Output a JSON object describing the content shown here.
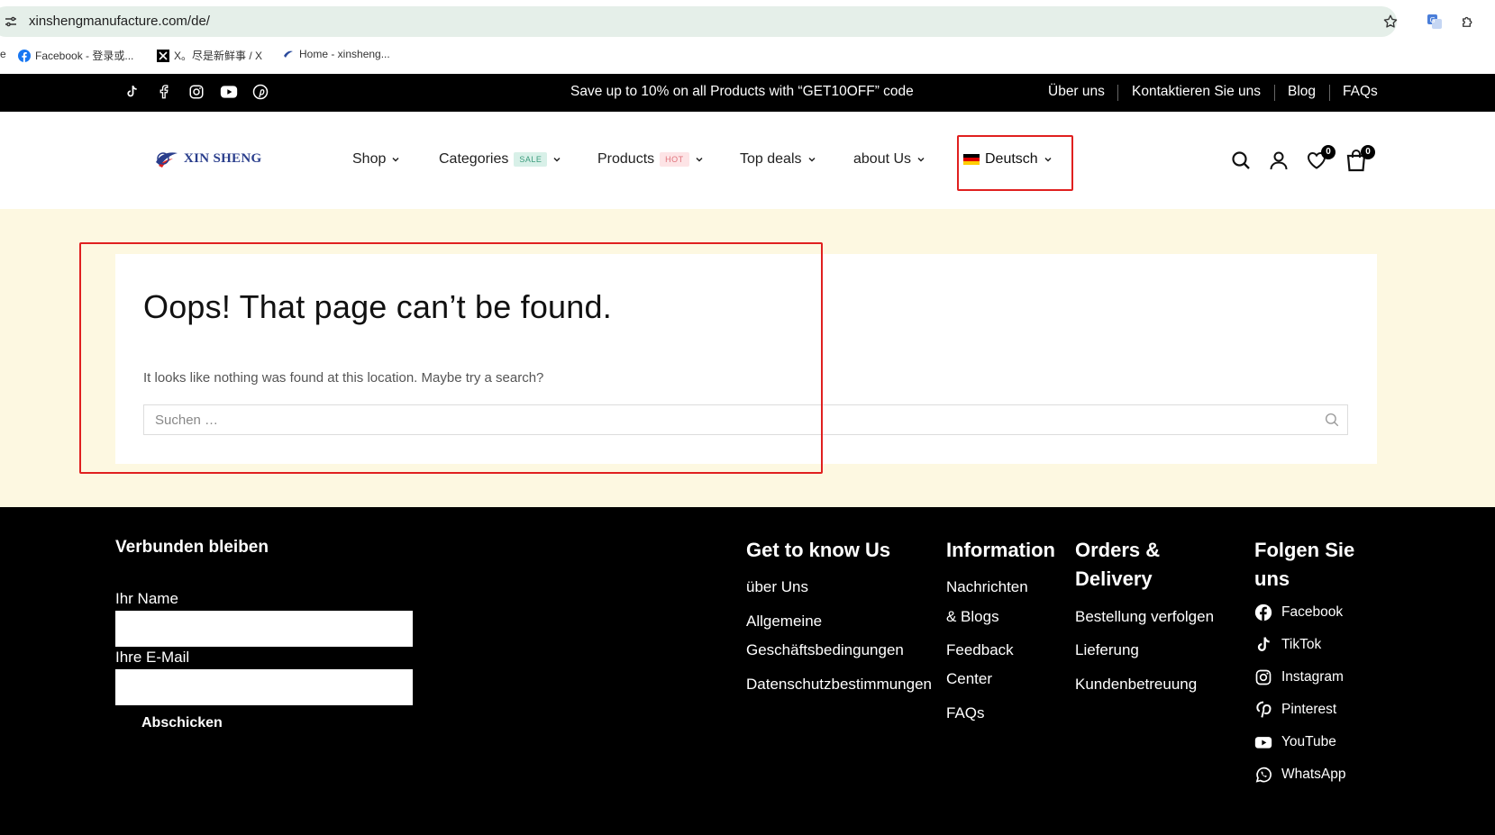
{
  "browser": {
    "url": "xinshengmanufacture.com/de/",
    "bookmarks": [
      {
        "label": "Facebook - 登录或..."
      },
      {
        "label": "X。尽是新鲜事 / X"
      },
      {
        "label": "Home - xinsheng..."
      }
    ]
  },
  "topbar": {
    "promo": "Save up to 10% on all Products with “GET10OFF” code",
    "links": [
      "Über uns",
      "Kontaktieren Sie uns",
      "Blog",
      "FAQs"
    ],
    "social_icons": [
      "tiktok-icon",
      "facebook-icon",
      "instagram-icon",
      "youtube-icon",
      "pinterest-icon"
    ]
  },
  "header": {
    "logo_text": "XIN SHENG",
    "nav": [
      {
        "label": "Shop",
        "badge": ""
      },
      {
        "label": "Categories",
        "badge": "SALE"
      },
      {
        "label": "Products",
        "badge": "HOT"
      },
      {
        "label": "Top deals",
        "badge": ""
      },
      {
        "label": "about Us",
        "badge": ""
      }
    ],
    "language": "Deutsch",
    "wishlist_count": "0",
    "cart_count": "0"
  },
  "main": {
    "title": "Oops! That page can’t be found.",
    "message": "It looks like nothing was found at this location. Maybe try a search?",
    "search_placeholder": "Suchen …"
  },
  "footer": {
    "stay_connected": "Verbunden bleiben",
    "name_label": "Ihr Name",
    "email_label": "Ihre E-Mail",
    "submit": "Abschicken",
    "col_know_title": "Get to know Us",
    "col_know_links": [
      "über Uns",
      "Allgemeine",
      "Geschäftsbedingungen",
      "Datenschutzbestimmungen"
    ],
    "col_info_title": "Information",
    "col_info_links": [
      "Nachrichten",
      "& Blogs",
      "Feedback",
      "Center",
      "FAQs"
    ],
    "col_orders_title_1": "Orders &",
    "col_orders_title_2": "Delivery",
    "col_orders_links": [
      "Bestellung verfolgen",
      "Lieferung",
      "Kundenbetreuung"
    ],
    "col_follow_title_1": "Folgen Sie",
    "col_follow_title_2": "uns",
    "follow": [
      {
        "label": "Facebook",
        "icon": "facebook-icon"
      },
      {
        "label": "TikTok",
        "icon": "tiktok-icon"
      },
      {
        "label": "Instagram",
        "icon": "instagram-icon"
      },
      {
        "label": "Pinterest",
        "icon": "pinterest-icon"
      },
      {
        "label": "YouTube",
        "icon": "youtube-icon"
      },
      {
        "label": "WhatsApp",
        "icon": "whatsapp-icon"
      }
    ]
  },
  "colors": {
    "highlight": "#e0201f",
    "main_bg": "#fdf8e1",
    "url_bar": "#e5efe9"
  }
}
